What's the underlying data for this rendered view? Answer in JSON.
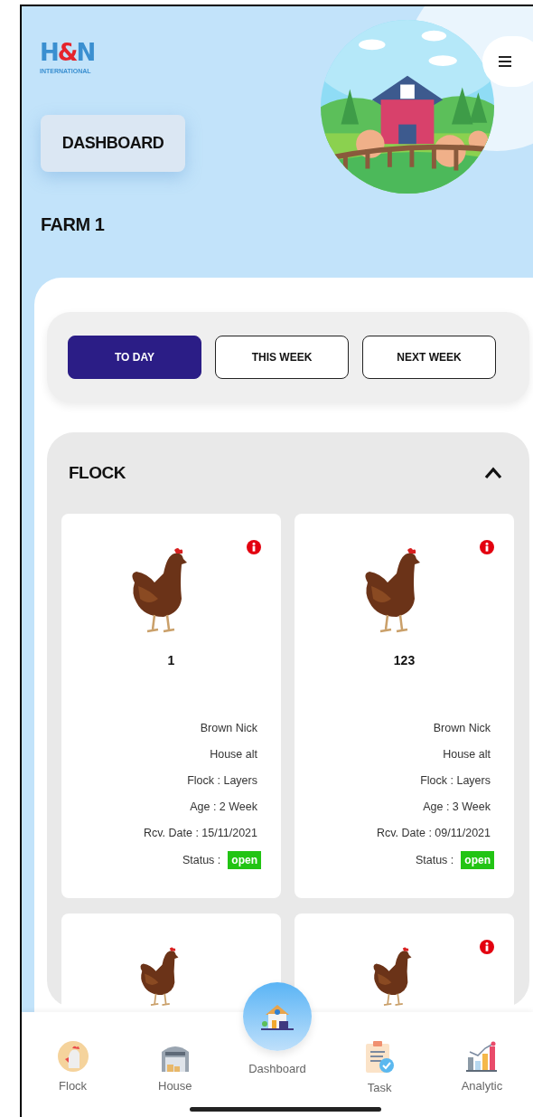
{
  "logo": {
    "parts": [
      "H",
      "&",
      "N"
    ],
    "subtitle": "INTERNATIONAL"
  },
  "page_button": "DASHBOARD",
  "farm_name": "FARM 1",
  "periods": [
    {
      "label": "TO DAY",
      "selected": true
    },
    {
      "label": "THIS WEEK",
      "selected": false
    },
    {
      "label": "NEXT WEEK",
      "selected": false
    }
  ],
  "flock": {
    "title": "FLOCK",
    "expanded": true,
    "cards": [
      {
        "alert": true,
        "number": "1",
        "details": [
          "Brown Nick",
          "House alt",
          "Flock : Layers",
          "Age : 2 Week",
          "Rcv. Date : 15/11/2021"
        ],
        "status_label": "Status :",
        "status": "open"
      },
      {
        "alert": true,
        "number": "123",
        "details": [
          "Brown Nick",
          "House alt",
          "Flock : Layers",
          "Age : 3 Week",
          "Rcv. Date : 09/11/2021"
        ],
        "status_label": "Status :",
        "status": "open"
      },
      {
        "alert": false
      },
      {
        "alert": true
      }
    ]
  },
  "nav": [
    {
      "label": "Flock",
      "kind": "flock",
      "selected": false
    },
    {
      "label": "House",
      "kind": "house",
      "selected": false
    },
    {
      "label": "Dashboard",
      "kind": "dashboard",
      "selected": true
    },
    {
      "label": "Task",
      "kind": "task",
      "selected": false
    },
    {
      "label": "Analytic",
      "kind": "analytic",
      "selected": false
    }
  ]
}
